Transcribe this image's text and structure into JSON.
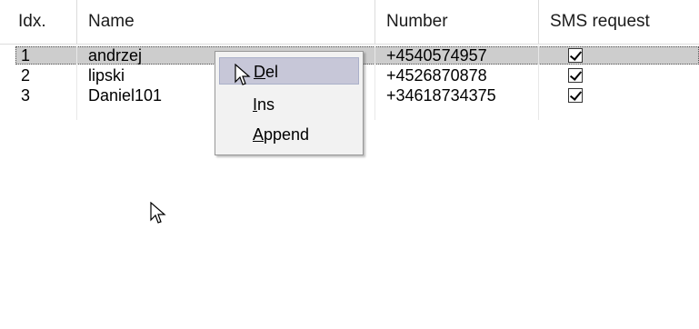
{
  "columns": [
    "Idx.",
    "Name",
    "Number",
    "SMS request"
  ],
  "rows": [
    {
      "idx": "1",
      "name": "andrzej",
      "number": "+4540574957",
      "sms": true
    },
    {
      "idx": "2",
      "name": "lipski",
      "number": "+4526870878",
      "sms": true
    },
    {
      "idx": "3",
      "name": "Daniel101",
      "number": "+34618734375",
      "sms": true
    }
  ],
  "context_menu": {
    "items": [
      {
        "accel": "D",
        "rest": "el"
      },
      {
        "accel": "I",
        "rest": "ns"
      },
      {
        "accel": "A",
        "rest": "ppend"
      }
    ]
  },
  "icons": [
    "checkbox-checked-icon",
    "mouse-pointer-icon"
  ],
  "colors": {
    "selected_row": "#cdcdcd",
    "menu_bg": "#f2f2f2",
    "menu_hover": "#c7c7d8"
  }
}
